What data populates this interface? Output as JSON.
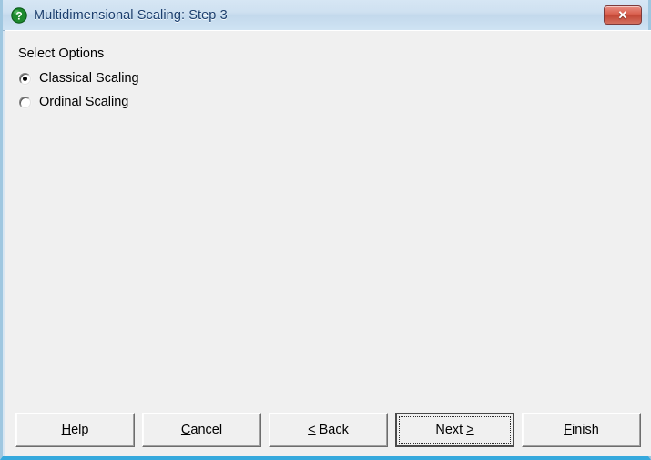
{
  "window": {
    "title": "Multidimensional Scaling: Step 3",
    "icon": "help-question-icon",
    "close_label": "✕",
    "title_color": "#1c3f6e",
    "frame_accent_color": "#36a9dd",
    "client_background": "#f0f0f0"
  },
  "options": {
    "group_label": "Select Options",
    "items": [
      {
        "label": "Classical Scaling",
        "selected": true
      },
      {
        "label": "Ordinal Scaling",
        "selected": false
      }
    ]
  },
  "buttons": [
    {
      "name": "help",
      "pre": "",
      "accel": "H",
      "post": "elp",
      "default": false
    },
    {
      "name": "cancel",
      "pre": "",
      "accel": "C",
      "post": "ancel",
      "default": false
    },
    {
      "name": "back",
      "pre": "",
      "accel": "<",
      "post": " Back",
      "default": false
    },
    {
      "name": "next",
      "pre": "Next ",
      "accel": ">",
      "post": "",
      "default": true
    },
    {
      "name": "finish",
      "pre": "",
      "accel": "F",
      "post": "inish",
      "default": false
    }
  ]
}
